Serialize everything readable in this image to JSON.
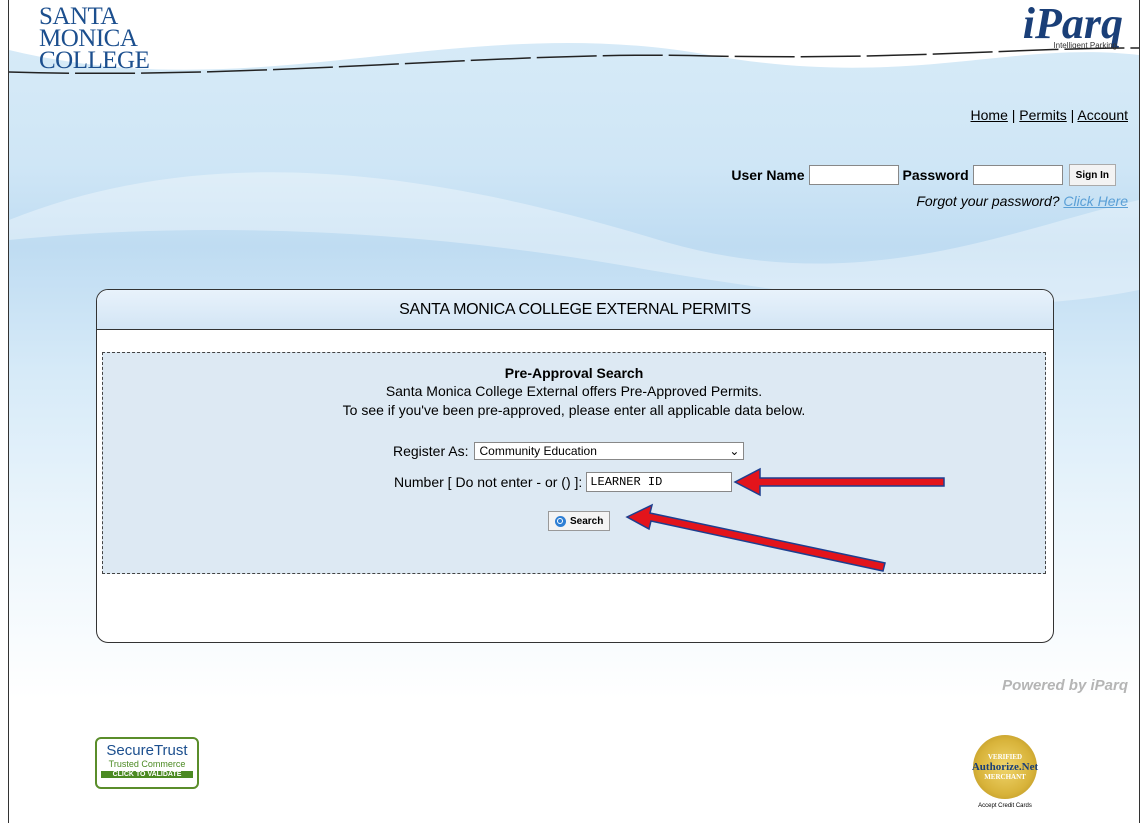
{
  "logo": {
    "line1": "SANTA",
    "line2": "MONICA",
    "line3": "COLLEGE"
  },
  "brand": {
    "name": "iParq",
    "tagline": "Intelligent Parking"
  },
  "nav": {
    "home": "Home",
    "sep1": "|",
    "permits": "Permits",
    "sep2": "|",
    "account": "Account"
  },
  "login": {
    "user_label": "User Name",
    "password_label": "Password",
    "signin_label": "Sign In",
    "forgot_text": "Forgot your password?",
    "forgot_link": "Click Here"
  },
  "panel": {
    "title": "SANTA MONICA COLLEGE EXTERNAL PERMITS"
  },
  "search": {
    "title": "Pre-Approval Search",
    "desc1": "Santa Monica College External offers Pre-Approved Permits.",
    "desc2": "To see if you've been pre-approved, please enter all applicable data below.",
    "register_label": "Register As:",
    "register_value": "Community Education",
    "number_label": "Number [ Do not enter - or () ]:",
    "number_value": "LEARNER ID",
    "button_label": "Search"
  },
  "footer": {
    "powered": "Powered by iParq",
    "securetrust": {
      "name": "SecureTrust",
      "sub": "Trusted Commerce",
      "cta": "CLICK TO VALIDATE"
    },
    "authorize": {
      "top": "VERIFIED",
      "name": "Authorize.Net",
      "bottom": "MERCHANT",
      "caption": "Accept Credit Cards"
    }
  },
  "colors": {
    "link": "#5a9fd6",
    "arrow": "#e3141b",
    "arrow_outline": "#1e3f8f",
    "brand": "#1c4f8e"
  }
}
